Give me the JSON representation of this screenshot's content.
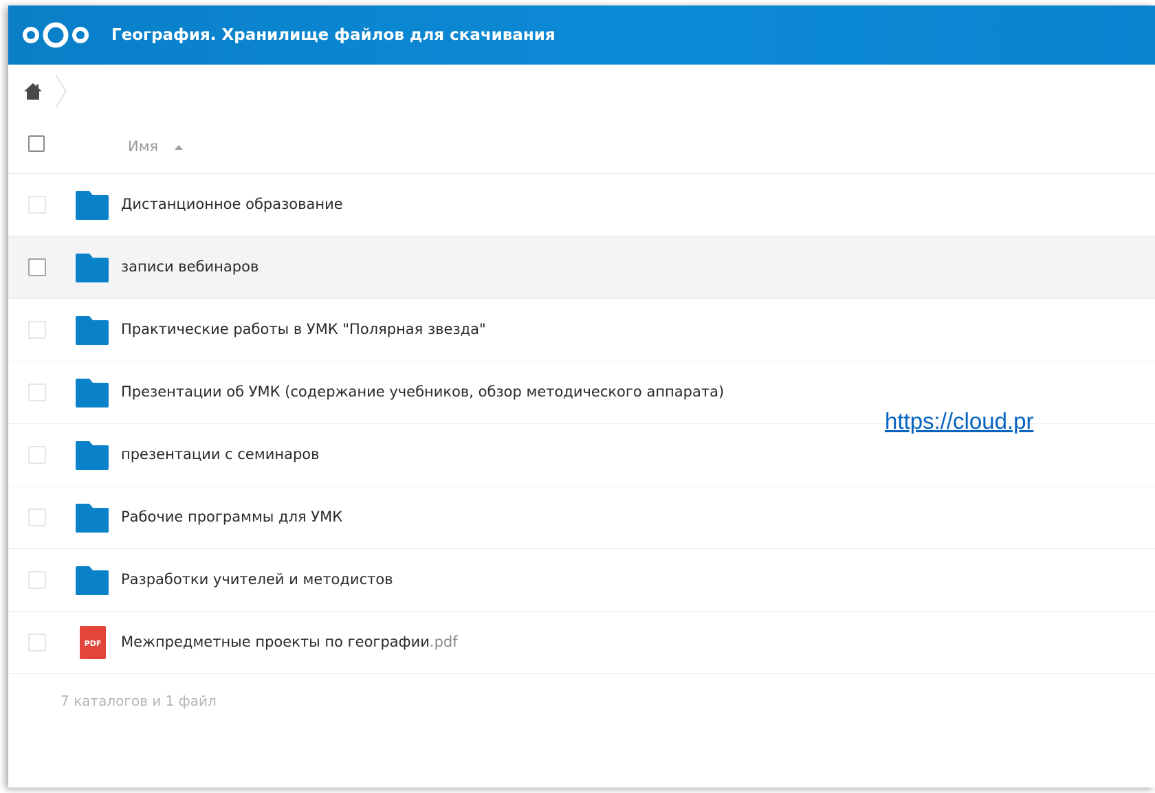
{
  "header": {
    "title": "География. Хранилище файлов для скачивания",
    "logo_icon": "nextcloud-logo-icon",
    "background": "#0a82cc"
  },
  "breadcrumb": {
    "home_icon": "home-icon"
  },
  "list_header": {
    "name_column": "Имя",
    "sort": "ascending"
  },
  "files": [
    {
      "name": "Дистанционное образование",
      "ext": "",
      "type": "folder",
      "highlighted": false
    },
    {
      "name": "записи вебинаров",
      "ext": "",
      "type": "folder",
      "highlighted": true
    },
    {
      "name": "Практические работы в УМК \"Полярная звезда\"",
      "ext": "",
      "type": "folder",
      "highlighted": false
    },
    {
      "name": "Презентации об УМК (содержание учебников, обзор методического аппарата)",
      "ext": "",
      "type": "folder",
      "highlighted": false
    },
    {
      "name": "презентации с семинаров",
      "ext": "",
      "type": "folder",
      "highlighted": false
    },
    {
      "name": "Рабочие программы для УМК",
      "ext": "",
      "type": "folder",
      "highlighted": false
    },
    {
      "name": "Разработки учителей и методистов",
      "ext": "",
      "type": "folder",
      "highlighted": false
    },
    {
      "name": "Межпредметные проекты по географии",
      "ext": ".pdf",
      "type": "pdf",
      "highlighted": false
    }
  ],
  "pdf_label": "PDF",
  "summary": "7 каталогов и 1 файл",
  "overlay_link": "https://cloud.pr",
  "colors": {
    "folder": "#0a82c9",
    "pdf": "#e2463b",
    "link": "#0563c1"
  }
}
